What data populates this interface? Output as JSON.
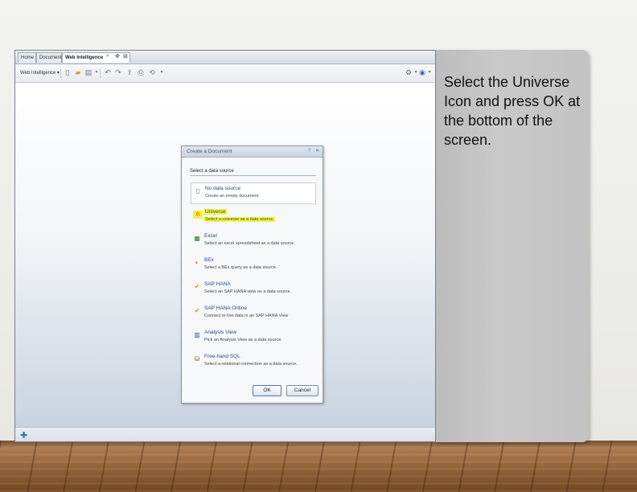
{
  "slide": {
    "instruction": "Select the Universe Icon and press OK at the bottom of the screen."
  },
  "app": {
    "tabs": [
      {
        "label": "Home"
      },
      {
        "label": "Documents"
      },
      {
        "label": "Web Intelligence",
        "active": true
      }
    ],
    "tab_controls": [
      "⌕",
      "✥",
      "⊠"
    ],
    "toolbar": {
      "mode_label": "Web Intelligence ▾"
    }
  },
  "dialog": {
    "title": "Create a Document",
    "heading": "Select a data source",
    "sources": [
      {
        "name": "No data source",
        "desc": "Create an empty document",
        "icon": "blank-document-icon",
        "selected": true
      },
      {
        "name": "Universe",
        "desc": "Select a universe as a data source.",
        "icon": "universe-icon",
        "highlighted": true
      },
      {
        "name": "Excel",
        "desc": "Select an excel spreadsheet as a data source.",
        "icon": "excel-icon"
      },
      {
        "name": "BEx",
        "desc": "Select a BEx query as a data source.",
        "icon": "bex-icon"
      },
      {
        "name": "SAP HANA",
        "desc": "Select an SAP HANA view as a data source.",
        "icon": "sap-hana-icon"
      },
      {
        "name": "SAP HANA Online",
        "desc": "Connect to live data in an SAP HANA View",
        "icon": "sap-hana-online-icon"
      },
      {
        "name": "Analysis View",
        "desc": "Pick an Analysis View as a data source.",
        "icon": "analysis-view-icon"
      },
      {
        "name": "Free-hand SQL",
        "desc": "Select a relational connection as a data source.",
        "icon": "free-hand-sql-icon"
      }
    ],
    "ok_label": "OK",
    "cancel_label": "Cancel"
  },
  "colors": {
    "highlight": "#f5f53a",
    "link_blue": "#234a8a",
    "panel_gray": "#c3c3c3"
  }
}
